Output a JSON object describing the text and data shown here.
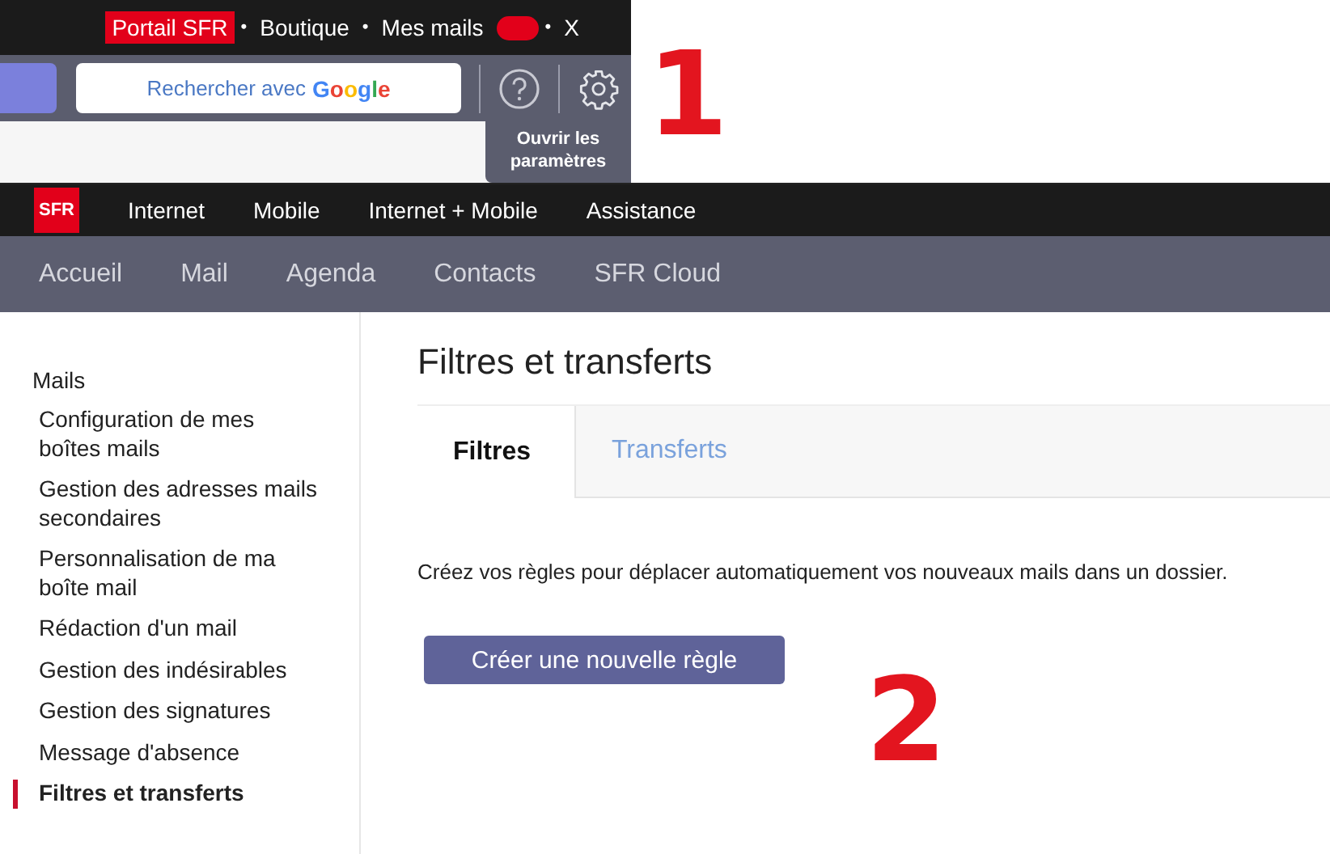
{
  "top_bar": {
    "links": [
      {
        "label": "Portail SFR",
        "selected": true
      },
      {
        "label": "Boutique",
        "selected": false
      },
      {
        "label": "Mes mails",
        "selected": false
      }
    ],
    "separator": "•",
    "close": "X"
  },
  "toolbar": {
    "search_label": "Rechercher avec",
    "search_brand": "Google",
    "tooltip": "Ouvrir les paramètres"
  },
  "annotations": [
    "1",
    "2"
  ],
  "brand_nav": {
    "logo": "SFR",
    "items": [
      "Internet",
      "Mobile",
      "Internet + Mobile",
      "Assistance"
    ]
  },
  "main_nav": {
    "items": [
      "Accueil",
      "Mail",
      "Agenda",
      "Contacts",
      "SFR Cloud"
    ]
  },
  "sidebar": {
    "heading": "Mails",
    "items": [
      {
        "label": "Configuration de mes boîtes mails",
        "selected": false
      },
      {
        "label": "Gestion des adresses mails secondaires",
        "selected": false
      },
      {
        "label": "Personnalisation de ma boîte mail",
        "selected": false
      },
      {
        "label": "Rédaction d'un mail",
        "selected": false
      },
      {
        "label": "Gestion des indésirables",
        "selected": false
      },
      {
        "label": "Gestion des signatures",
        "selected": false
      },
      {
        "label": "Message d'absence",
        "selected": false
      },
      {
        "label": "Filtres et transferts",
        "selected": true
      }
    ]
  },
  "content": {
    "title": "Filtres et transferts",
    "tabs": [
      {
        "label": "Filtres",
        "selected": true
      },
      {
        "label": "Transferts",
        "selected": false
      }
    ],
    "description": "Créez vos règles pour déplacer automatiquement vos nouveaux mails dans un dossier.",
    "button": "Créer une nouvelle règle"
  }
}
